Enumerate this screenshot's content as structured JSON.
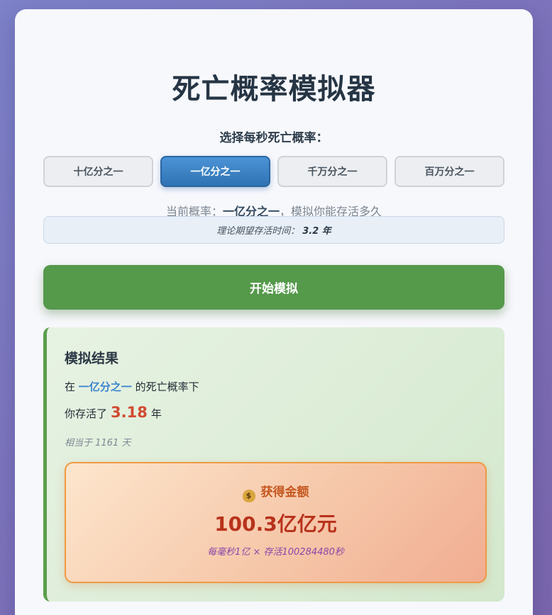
{
  "title": "死亡概率模拟器",
  "select_label": "选择每秒死亡概率：",
  "options": [
    {
      "label": "十亿分之一",
      "active": false
    },
    {
      "label": "一亿分之一",
      "active": true
    },
    {
      "label": "千万分之一",
      "active": false
    },
    {
      "label": "百万分之一",
      "active": false
    }
  ],
  "current": {
    "prefix": "当前概率：",
    "value": "一亿分之一",
    "suffix": "，模拟你能存活多久"
  },
  "expectation": {
    "label": "理论期望存活时间：",
    "value": "3.2 年"
  },
  "start_button": "开始模拟",
  "result": {
    "heading": "模拟结果",
    "line1_prefix": "在",
    "line1_prob": "一亿分之一",
    "line1_suffix": "的死亡概率下",
    "line2_prefix": "你存活了",
    "years": "3.18",
    "line2_suffix": "年",
    "days_text": "相当于 1161 天",
    "money": {
      "icon": "money-bag-icon",
      "label": "获得金额",
      "amount": "100.3亿亿元",
      "note": "每毫秒1亿 × 存活100284480秒"
    }
  },
  "colors": {
    "accent_blue": "#3c85cf",
    "start_green": "#55994b",
    "years_red": "#d24a32",
    "money_border": "#ee9a44"
  }
}
